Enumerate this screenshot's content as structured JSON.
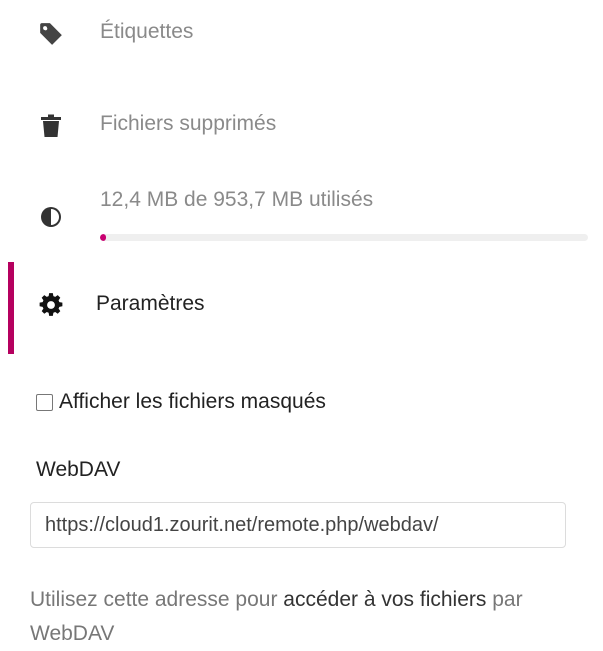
{
  "sidebar": {
    "items": [
      {
        "label": "Étiquettes",
        "icon": "tag-icon"
      },
      {
        "label": "Fichiers supprimés",
        "icon": "trash-icon"
      },
      {
        "label": "Paramètres",
        "icon": "gear-icon"
      }
    ],
    "quota": {
      "label": "12,4 MB de 953,7 MB utilisés",
      "used_fraction": 0.013,
      "icon": "pie-icon"
    }
  },
  "settings": {
    "show_hidden_label": "Afficher les fichiers masqués",
    "show_hidden_checked": false,
    "webdav_title": "WebDAV",
    "webdav_url": "https://cloud1.zourit.net/remote.php/webdav/",
    "help_prefix": "Utilisez cette adresse pour ",
    "help_link": "accéder à vos fichiers",
    "help_suffix": " par WebDAV"
  },
  "colors": {
    "accent": "#b5005f",
    "quota_fill": "#c80070"
  }
}
